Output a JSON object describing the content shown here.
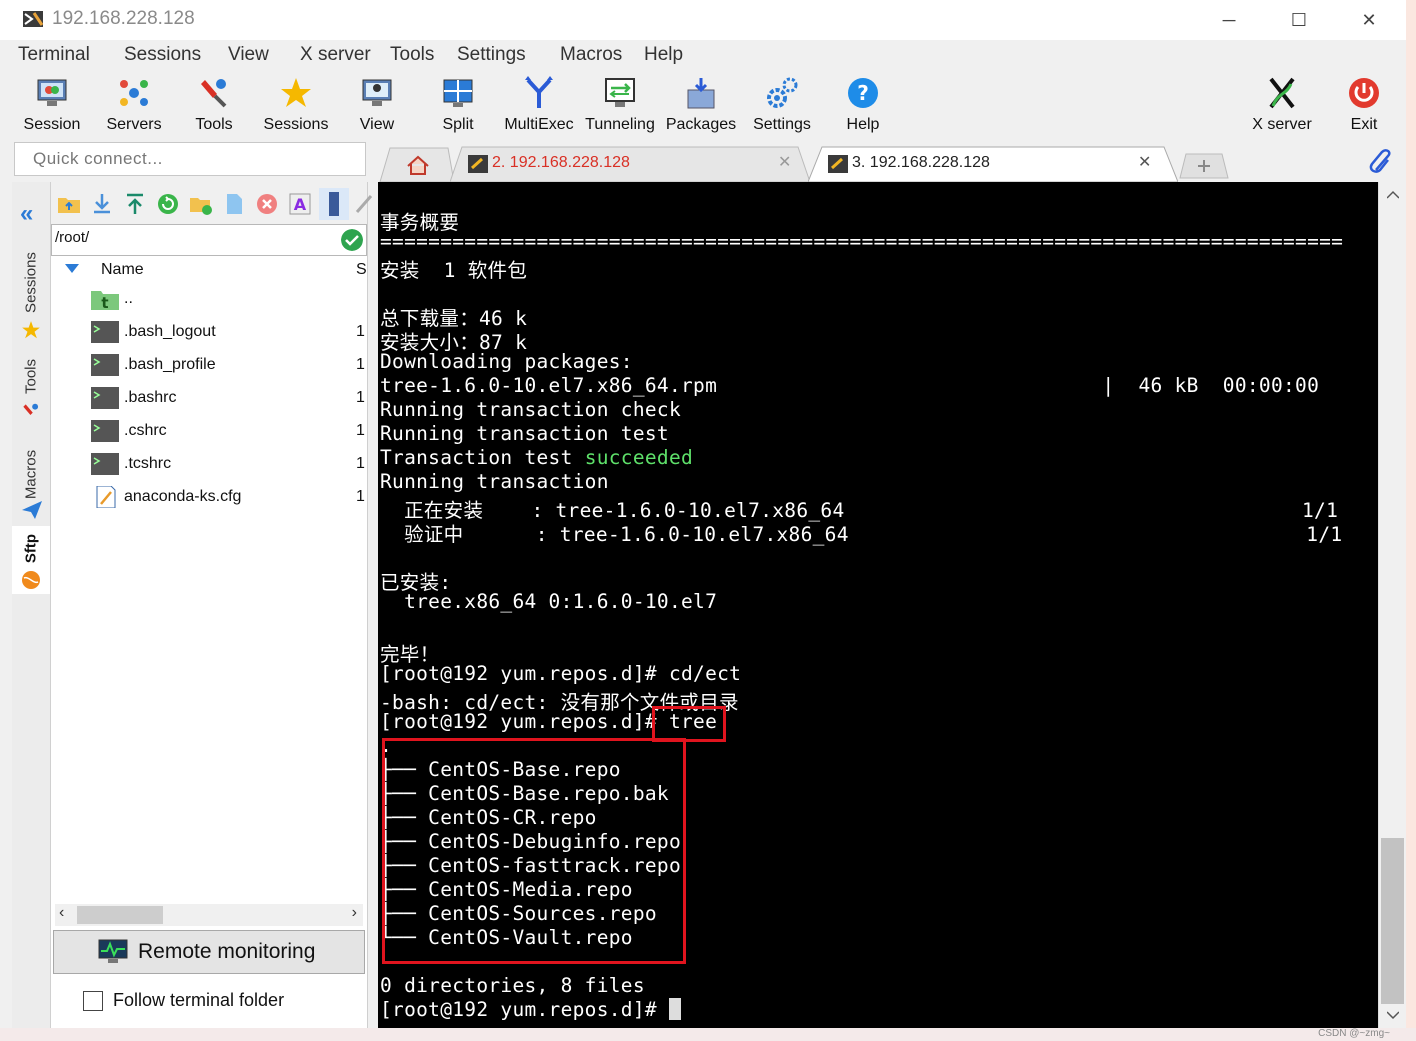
{
  "window": {
    "title": "192.168.228.128",
    "controls": {
      "minimize": "─",
      "maximize": "☐",
      "close": "✕"
    }
  },
  "menu": [
    "Terminal",
    "Sessions",
    "View",
    "X server",
    "Tools",
    "Settings",
    "Macros",
    "Help"
  ],
  "toolbar": {
    "buttons": [
      {
        "label": "Session",
        "icon": "session-icon"
      },
      {
        "label": "Servers",
        "icon": "servers-icon"
      },
      {
        "label": "Tools",
        "icon": "tools-icon"
      },
      {
        "label": "Sessions",
        "icon": "star-icon"
      },
      {
        "label": "View",
        "icon": "view-icon"
      },
      {
        "label": "Split",
        "icon": "split-icon"
      },
      {
        "label": "MultiExec",
        "icon": "multiexec-icon"
      },
      {
        "label": "Tunneling",
        "icon": "tunneling-icon"
      },
      {
        "label": "Packages",
        "icon": "packages-icon"
      },
      {
        "label": "Settings",
        "icon": "settings-icon"
      },
      {
        "label": "Help",
        "icon": "help-icon"
      },
      {
        "label": "X server",
        "icon": "xserver-icon"
      },
      {
        "label": "Exit",
        "icon": "exit-icon"
      }
    ]
  },
  "quick_connect": {
    "placeholder": "Quick connect..."
  },
  "tabs": [
    {
      "label": "2. 192.168.228.128",
      "active": false,
      "color": "#d93025"
    },
    {
      "label": "3. 192.168.228.128",
      "active": true,
      "color": "#222222"
    }
  ],
  "side_tabs": [
    "Sessions",
    "Tools",
    "Macros",
    "Sftp"
  ],
  "sftp": {
    "path": "/root/",
    "column_name": "Name",
    "column_size": "S",
    "files": [
      {
        "name": "..",
        "size": "",
        "type": "parent"
      },
      {
        "name": ".bash_logout",
        "size": "1",
        "type": "terminal"
      },
      {
        "name": ".bash_profile",
        "size": "1",
        "type": "terminal"
      },
      {
        "name": ".bashrc",
        "size": "1",
        "type": "terminal"
      },
      {
        "name": ".cshrc",
        "size": "1",
        "type": "terminal"
      },
      {
        "name": ".tcshrc",
        "size": "1",
        "type": "terminal"
      },
      {
        "name": "anaconda-ks.cfg",
        "size": "1",
        "type": "text"
      }
    ],
    "remote_monitoring": "Remote monitoring",
    "follow_terminal": "Follow terminal folder"
  },
  "terminal": {
    "lines": [
      "",
      "事务概要",
      "================================================================================",
      "安装  1 软件包",
      "",
      "总下载量：46 k",
      "安装大小：87 k",
      "Downloading packages:",
      "tree-1.6.0-10.el7.x86_64.rpm                                |  46 kB  00:00:00",
      "Running transaction check",
      "Running transaction test",
      "Transaction test ",
      "Running transaction",
      "  正在安装    : tree-1.6.0-10.el7.x86_64                                      1/1",
      "  验证中      : tree-1.6.0-10.el7.x86_64                                      1/1",
      "",
      "已安装:",
      "  tree.x86_64 0:1.6.0-10.el7",
      "",
      "完毕！",
      "[root@192 yum.repos.d]# cd/ect",
      "-bash: cd/ect: 没有那个文件或目录",
      "[root@192 yum.repos.d]# tree",
      ".",
      "├── CentOS-Base.repo",
      "├── CentOS-Base.repo.bak",
      "├── CentOS-CR.repo",
      "├── CentOS-Debuginfo.repo",
      "├── CentOS-fasttrack.repo",
      "├── CentOS-Media.repo",
      "├── CentOS-Sources.repo",
      "└── CentOS-Vault.repo",
      "",
      "0 directories, 8 files",
      "[root@192 yum.repos.d]# "
    ],
    "succeeded_word": "succeeded"
  },
  "watermark": "CSDN @~zmg~"
}
